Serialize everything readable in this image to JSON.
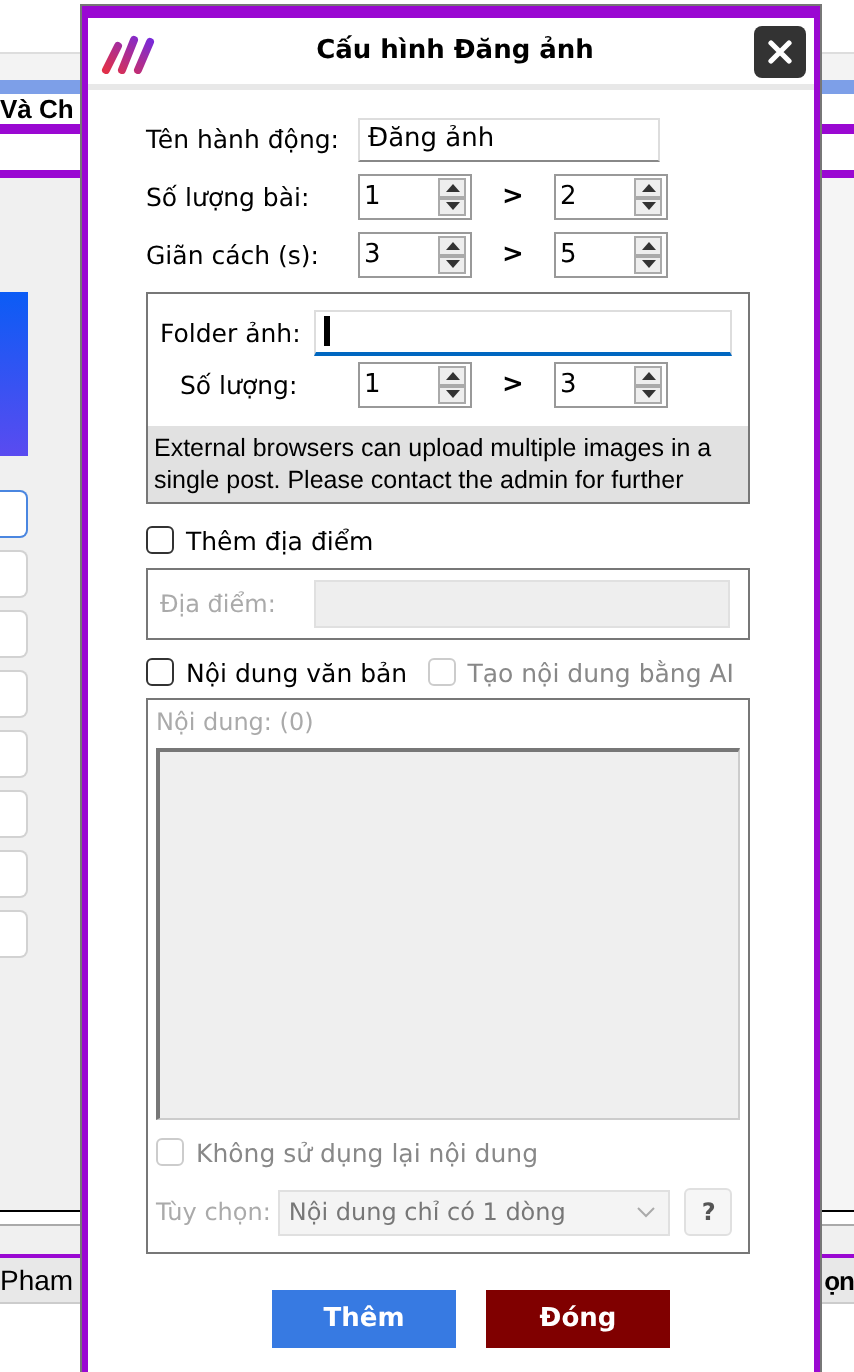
{
  "background": {
    "header_text": "Và Ch",
    "list_items": [
      {
        "selected": true
      },
      {
        "selected": false
      },
      {
        "selected": false
      },
      {
        "selected": false
      },
      {
        "selected": false
      },
      {
        "selected": false
      },
      {
        "selected": false
      },
      {
        "selected": false
      }
    ],
    "footer_left": "Pham",
    "footer_right": "ọn"
  },
  "dialog": {
    "title": "Cấu hình Đăng ảnh",
    "action_name": {
      "label": "Tên hành động:",
      "value": "Đăng ảnh"
    },
    "ranges": [
      {
        "label": "Số lượng bài:",
        "min": "1",
        "separator": ">",
        "max": "2"
      },
      {
        "label": "Giãn cách (s):",
        "min": "3",
        "separator": ">",
        "max": "5"
      }
    ],
    "folder_group": {
      "label": "Folder ảnh:",
      "focused": true,
      "count": {
        "label": "Số lượng:",
        "min": "1",
        "separator": ">",
        "max": "3"
      },
      "note": "External browsers can upload multiple images in a single post. Please contact the admin for further"
    },
    "location": {
      "label": "Thêm địa điểm",
      "checked": false,
      "field_label": "Địa điểm:",
      "field_disabled": true
    },
    "content": {
      "label": "Nội dung văn bản",
      "checked": false,
      "ai_option": {
        "label": "Tạo nội dung bằng AI",
        "checked": false,
        "disabled": true
      },
      "content_label": "Nội dung: (0)",
      "no_reuse": {
        "label": "Không sử dụng lại nội dung",
        "checked": false,
        "disabled": true
      },
      "option_label": "Tùy chọn:",
      "option_value": "Nội dung chỉ có 1 dòng",
      "help": "?"
    },
    "buttons": [
      {
        "label": "Thêm",
        "kind": "primary"
      },
      {
        "label": "Đóng",
        "kind": "danger"
      }
    ]
  }
}
